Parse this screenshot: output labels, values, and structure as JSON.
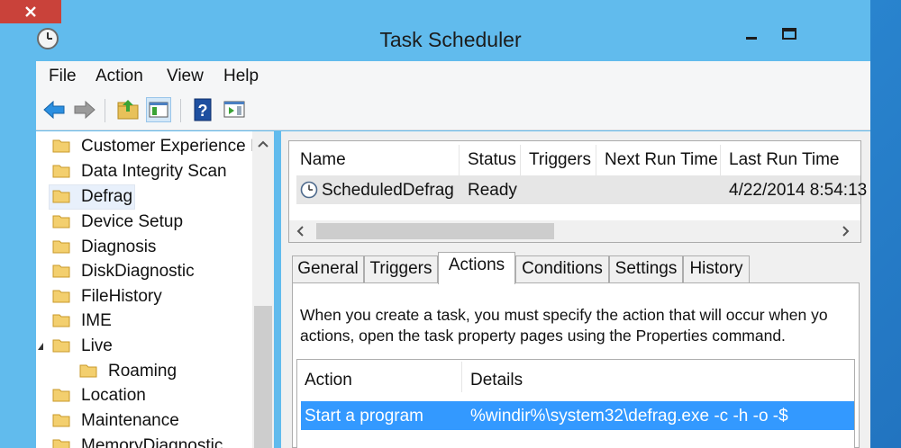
{
  "window": {
    "title": "Task Scheduler"
  },
  "menu": {
    "items": [
      "File",
      "Action",
      "View",
      "Help"
    ]
  },
  "toolbar": {
    "buttons": [
      "back-arrow-icon",
      "forward-arrow-icon",
      "up-folder-icon",
      "show-hide-tree-icon",
      "help-icon",
      "action-pane-icon"
    ]
  },
  "tree": {
    "items": [
      {
        "label": "Customer Experience Ir"
      },
      {
        "label": "Data Integrity Scan"
      },
      {
        "label": "Defrag",
        "selected": true
      },
      {
        "label": "Device Setup"
      },
      {
        "label": "Diagnosis"
      },
      {
        "label": "DiskDiagnostic"
      },
      {
        "label": "FileHistory"
      },
      {
        "label": "IME"
      },
      {
        "label": "Live",
        "expanded": true
      },
      {
        "label": "Roaming",
        "child": true
      },
      {
        "label": "Location"
      },
      {
        "label": "Maintenance"
      },
      {
        "label": "MemoryDiagnostic"
      }
    ]
  },
  "tasks": {
    "columns": [
      "Name",
      "Status",
      "Triggers",
      "Next Run Time",
      "Last Run Time"
    ],
    "rows": [
      {
        "name": "ScheduledDefrag",
        "status": "Ready",
        "triggers": "",
        "next_run": "",
        "last_run": "4/22/2014 8:54:13"
      }
    ]
  },
  "detail": {
    "tabs": [
      "General",
      "Triggers",
      "Actions",
      "Conditions",
      "Settings",
      "History"
    ],
    "active_tab": "Actions",
    "description_line1": "When you create a task, you must specify the action that will occur when yo",
    "description_line2": "actions, open the task property pages using the Properties command.",
    "actions": {
      "columns": [
        "Action",
        "Details"
      ],
      "rows": [
        {
          "action": "Start a program",
          "details": "%windir%\\system32\\defrag.exe -c -h -o -$"
        }
      ]
    }
  },
  "colors": {
    "window_frame": "#61bbed",
    "close_button": "#c9423a",
    "selection": "#3399ff"
  }
}
